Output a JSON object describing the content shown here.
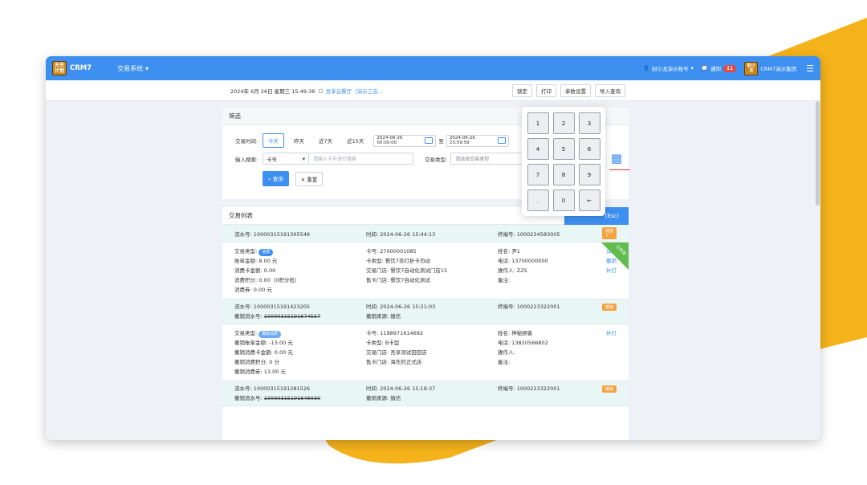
{
  "brand": {
    "logo_text": "天天 计划",
    "name": "CRM7",
    "accent": "#3d8ff0"
  },
  "topbar": {
    "system_menu": "交易系统",
    "account": "财小龙演示账号",
    "notify_label": "通知",
    "notify_count": "11",
    "org": "CRM7演示集团",
    "avatar_text": "财小 龙"
  },
  "subbar": {
    "datetime": "2024年 6月 26日  星期三  15:49:38",
    "store": "吾享云餐厅（演示三店...",
    "buttons": [
      "锁定",
      "打印",
      "参数设置",
      "导入查询"
    ]
  },
  "filter": {
    "title": "筛选",
    "time_label": "交易时间:",
    "time_chips": [
      "今天",
      "昨天",
      "近7天",
      "近15天"
    ],
    "date_from": "2024-06-26 00:00:00",
    "to_label": "至",
    "date_to": "2024-06-26 23:59:59",
    "search_label": "输入搜索:",
    "search_type": "卡号",
    "search_placeholder": "请输入卡号进行搜索",
    "trade_type_label": "交易类型:",
    "trade_type_placeholder": "请选择交易类型",
    "query_btn": "查询",
    "reset_btn": "重置"
  },
  "list": {
    "title": "交易列表",
    "esc_btn": "(Esc)",
    "records": [
      {
        "serial": "流水号:  10000315191305549",
        "time": "时间:  2024-06-26 15:44:13",
        "terminal": "终端号:  1000234583005",
        "tag": "储值7",
        "corner": "已作废",
        "col1": [
          {
            "k": "交易类型:",
            "pill": "消费"
          },
          {
            "k": "账单金额:  8.00 元"
          },
          {
            "k": "消费卡金额:  0.00"
          },
          {
            "k": "消费积分:  0.00（0积分抵）"
          },
          {
            "k": "消费券:  0.00 元"
          }
        ],
        "col2": [
          "卡号:  27000001085",
          "卡类型:  餐饮7非打折卡勿动",
          "交易门店:  餐饮7自动化测试门店15",
          "售卡门店:  餐饮7自动化测试"
        ],
        "col3": [
          "姓名:  尹1",
          "电话:  13700000000",
          "操作人:  ZZS",
          "备注:"
        ],
        "links": [
          "详情",
          "撤销",
          "补打"
        ]
      },
      {
        "serial": "流水号:  10000315191423205",
        "serial2": "撤销流水号:",
        "serial2_val": "10000315191674557",
        "time": "时间:  2024-06-26 15:21:03",
        "time2": "撤销来源:  微信",
        "terminal": "终端号:  1000223322001",
        "tag": "撤销",
        "col1": [
          {
            "k": "交易类型:",
            "pill": "撤销消费"
          },
          {
            "k": "撤销账单金额:  -13.00 元"
          },
          {
            "k": "撤销消费卡金额:  0.00 元"
          },
          {
            "k": "撤销消费积分:  0 分"
          },
          {
            "k": "撤销消费券:  13.00 元"
          }
        ],
        "col2": [
          "卡号:  1198971614692",
          "卡类型:  B卡型",
          "交易门店:  吾享测试田田店",
          "售卡门店:  海东的正式店"
        ],
        "col3": [
          "姓名:  神秘顾客",
          "电话:  13820566802",
          "操作人:",
          "备注:"
        ],
        "links": [
          "补打"
        ]
      },
      {
        "serial": "流水号:  10000315191281526",
        "serial2": "撤销流水号:",
        "serial2_val": "10000315191649030",
        "time": "时间:  2024-06-26 15:18:37",
        "time2": "撤销来源:  微信",
        "terminal": "终端号:  1000223322001",
        "tag": "撤销"
      }
    ]
  },
  "keypad": {
    "keys": [
      "1",
      "2",
      "3",
      "4",
      "5",
      "6",
      "7",
      "8",
      "9",
      ".",
      "0",
      "←"
    ]
  },
  "watermark": "财小龙演示账号"
}
